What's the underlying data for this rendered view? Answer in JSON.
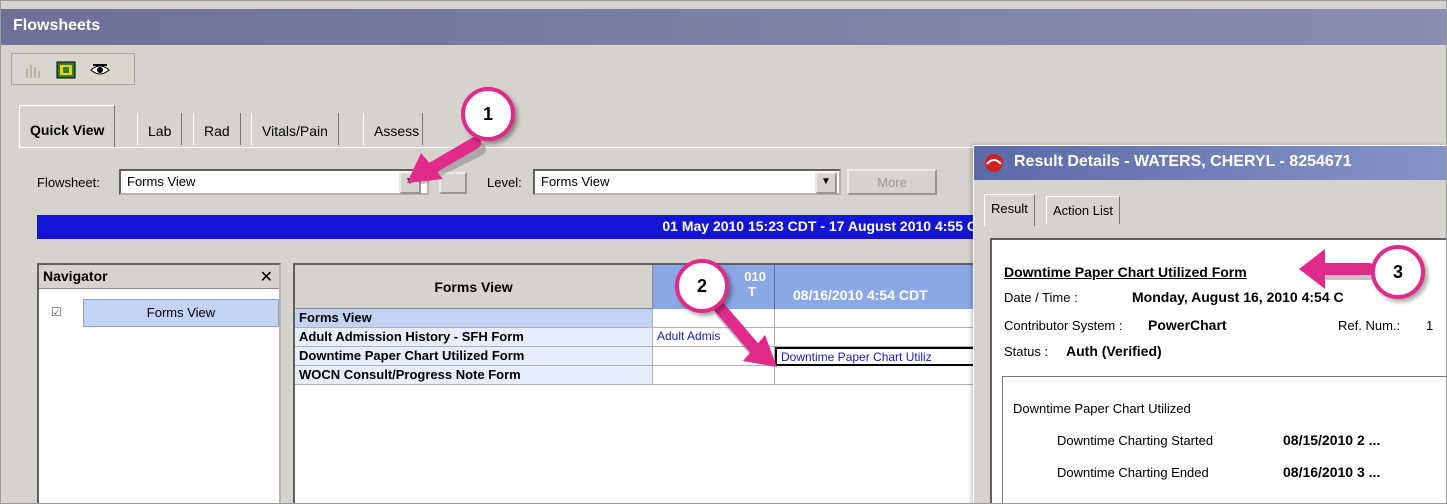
{
  "window": {
    "title": "Flowsheets"
  },
  "toolbar": {
    "icons": [
      "chart-icon",
      "grid-view-icon",
      "eye-view-icon"
    ]
  },
  "tabs": [
    {
      "label": "Quick View",
      "active": true
    },
    {
      "label": "Lab"
    },
    {
      "label": "Rad"
    },
    {
      "label": "Vitals/Pain"
    },
    {
      "label": "Assess"
    }
  ],
  "filters": {
    "flowsheet_label": "Flowsheet:",
    "flowsheet_value": "Forms View",
    "level_label": "Level:",
    "level_value": "Forms View",
    "more_label": "More"
  },
  "date_range": "01 May 2010 15:23 CDT - 17 August 2010 4:55 C",
  "navigator": {
    "title": "Navigator",
    "close": "✕",
    "items": [
      {
        "label": "Forms View",
        "checked": true
      }
    ]
  },
  "grid": {
    "header": "Forms View",
    "col1_header_top": "010",
    "col1_header_bottom": "T",
    "col2_header": "08/16/2010 4:54 CDT",
    "rows": [
      {
        "name": "Forms View",
        "c1": "",
        "c2": "",
        "section": true
      },
      {
        "name": "Adult Admission History - SFH Form",
        "c1": "Adult Admis",
        "c2": ""
      },
      {
        "name": "Downtime Paper Chart Utilized Form",
        "c1": "",
        "c2": "Downtime Paper Chart Utiliz"
      },
      {
        "name": "WOCN Consult/Progress Note Form",
        "c1": "",
        "c2": ""
      }
    ]
  },
  "callouts": [
    "1",
    "2",
    "3"
  ],
  "popup": {
    "title": "Result Details - WATERS, CHERYL - 8254671",
    "tabs": [
      "Result",
      "Action List"
    ],
    "form_title": "Downtime Paper Chart Utilized Form",
    "datetime_label": "Date / Time :",
    "datetime_value": "Monday, August 16, 2010 4:54 C",
    "contributor_label": "Contributor System :",
    "contributor_value": "PowerChart",
    "ref_label": "Ref. Num.:",
    "ref_value": "1",
    "status_label": "Status :",
    "status_value": "Auth (Verified)",
    "section_title": "Downtime Paper Chart Utilized",
    "fields": [
      {
        "label": "Downtime Charting Started",
        "value": "08/15/2010 2 ..."
      },
      {
        "label": "Downtime Charting Ended",
        "value": "08/16/2010 3 ..."
      }
    ]
  },
  "colors": {
    "accent": "#e22a8a",
    "date_bar": "#1414d6",
    "title_bar": "#6d6f96"
  }
}
